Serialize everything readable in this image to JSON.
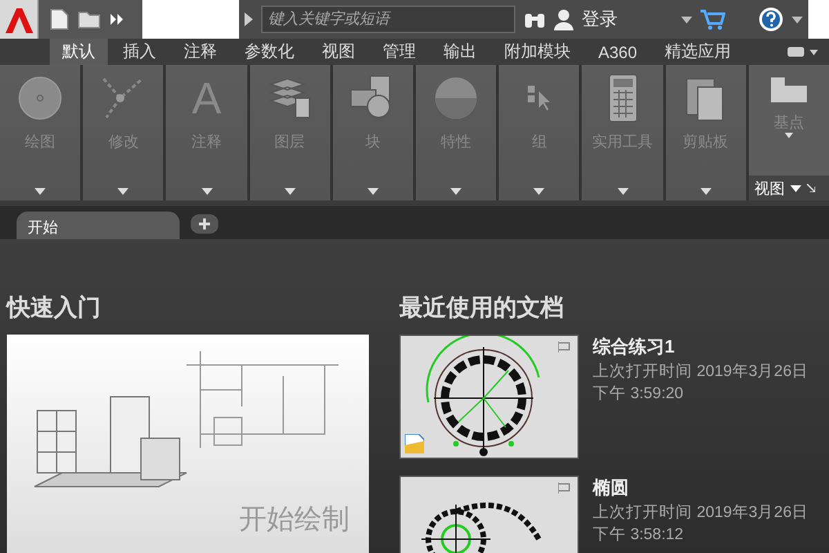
{
  "search": {
    "placeholder": "键入关键字或短语"
  },
  "login": {
    "label": "登录"
  },
  "ribbon_tabs": [
    {
      "label": "默认",
      "selected": true
    },
    {
      "label": "插入",
      "selected": false
    },
    {
      "label": "注释",
      "selected": false
    },
    {
      "label": "参数化",
      "selected": false
    },
    {
      "label": "视图",
      "selected": false
    },
    {
      "label": "管理",
      "selected": false
    },
    {
      "label": "输出",
      "selected": false
    },
    {
      "label": "附加模块",
      "selected": false
    },
    {
      "label": "A360",
      "selected": false
    },
    {
      "label": "精选应用",
      "selected": false
    }
  ],
  "ribbon_panels": [
    {
      "kind": "draw",
      "label": "绘图"
    },
    {
      "kind": "modify",
      "label": "修改"
    },
    {
      "kind": "glyph",
      "glyph": "A",
      "label": "注释"
    },
    {
      "kind": "layers",
      "label": "图层"
    },
    {
      "kind": "block",
      "label": "块"
    },
    {
      "kind": "properties",
      "label": "特性"
    },
    {
      "kind": "group",
      "label": "组"
    },
    {
      "kind": "utilities",
      "label": "实用工具"
    },
    {
      "kind": "clipboard",
      "label": "剪贴板"
    }
  ],
  "view_panel": {
    "tool": "基点",
    "footer": "视图"
  },
  "doc_tabs": [
    {
      "label": "开始",
      "selected": true
    }
  ],
  "quick_start": {
    "title": "快速入门",
    "caption": "开始绘制"
  },
  "recent": {
    "title": "最近使用的文档",
    "documents": [
      {
        "name": "综合练习1",
        "opened": "上次打开时间 2019年3月26日",
        "time": "下午 3:59:20",
        "badge": true
      },
      {
        "name": "椭圆",
        "opened": "上次打开时间 2019年3月26日",
        "time": "下午 3:58:12",
        "badge": false
      }
    ]
  }
}
